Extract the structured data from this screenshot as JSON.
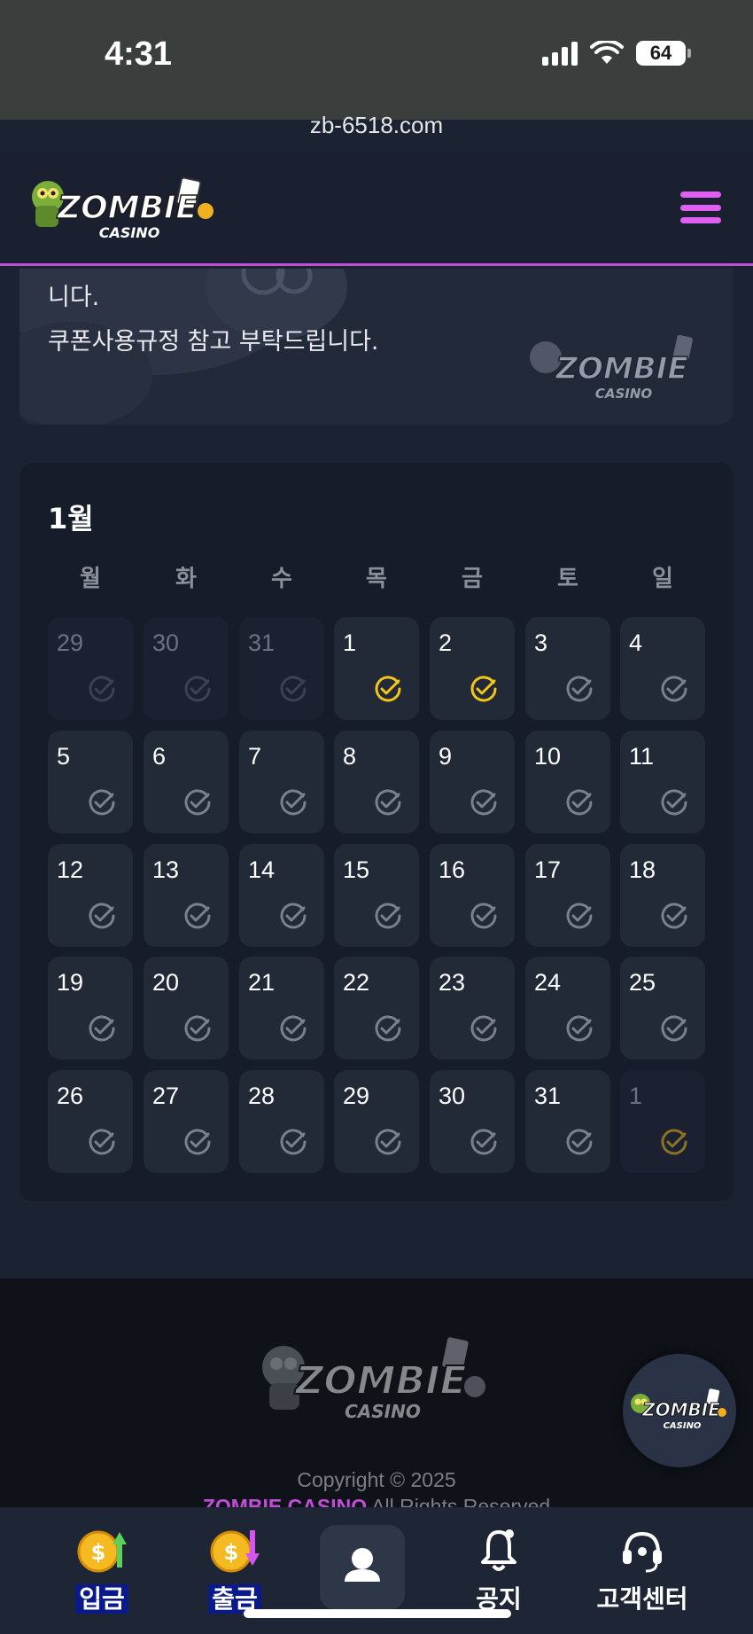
{
  "status_bar": {
    "time": "4:31",
    "battery": "64"
  },
  "browser": {
    "url": "zb-6518.com"
  },
  "header": {
    "logo_text": "ZOMBIE",
    "logo_sub": "CASINO"
  },
  "notice": {
    "lines": [
      "니다.",
      "쿠폰사용규정 참고 부탁드립니다."
    ]
  },
  "calendar": {
    "month": "1월",
    "weekdays": [
      "월",
      "화",
      "수",
      "목",
      "금",
      "토",
      "일"
    ],
    "days": [
      {
        "n": "29",
        "state": "other"
      },
      {
        "n": "30",
        "state": "other"
      },
      {
        "n": "31",
        "state": "other"
      },
      {
        "n": "1",
        "state": "checked"
      },
      {
        "n": "2",
        "state": "checked"
      },
      {
        "n": "3",
        "state": "normal"
      },
      {
        "n": "4",
        "state": "normal"
      },
      {
        "n": "5",
        "state": "normal"
      },
      {
        "n": "6",
        "state": "normal"
      },
      {
        "n": "7",
        "state": "normal"
      },
      {
        "n": "8",
        "state": "normal"
      },
      {
        "n": "9",
        "state": "normal"
      },
      {
        "n": "10",
        "state": "normal"
      },
      {
        "n": "11",
        "state": "normal"
      },
      {
        "n": "12",
        "state": "normal"
      },
      {
        "n": "13",
        "state": "normal"
      },
      {
        "n": "14",
        "state": "normal"
      },
      {
        "n": "15",
        "state": "normal"
      },
      {
        "n": "16",
        "state": "normal"
      },
      {
        "n": "17",
        "state": "normal"
      },
      {
        "n": "18",
        "state": "normal"
      },
      {
        "n": "19",
        "state": "normal"
      },
      {
        "n": "20",
        "state": "normal"
      },
      {
        "n": "21",
        "state": "normal"
      },
      {
        "n": "22",
        "state": "normal"
      },
      {
        "n": "23",
        "state": "normal"
      },
      {
        "n": "24",
        "state": "normal"
      },
      {
        "n": "25",
        "state": "normal"
      },
      {
        "n": "26",
        "state": "normal"
      },
      {
        "n": "27",
        "state": "normal"
      },
      {
        "n": "28",
        "state": "normal"
      },
      {
        "n": "29",
        "state": "normal"
      },
      {
        "n": "30",
        "state": "normal"
      },
      {
        "n": "31",
        "state": "normal"
      },
      {
        "n": "1",
        "state": "other-checked"
      }
    ]
  },
  "footer": {
    "copyright": "Copyright © 2025",
    "brand": "ZOMBIE CASINO",
    "rights": "All Rights Reserved"
  },
  "nav": {
    "deposit": "입금",
    "withdraw": "출금",
    "notice": "공지",
    "support": "고객센터"
  },
  "colors": {
    "accent": "#c14ed8",
    "check_active": "#f5c518",
    "bg": "#1b2231"
  }
}
